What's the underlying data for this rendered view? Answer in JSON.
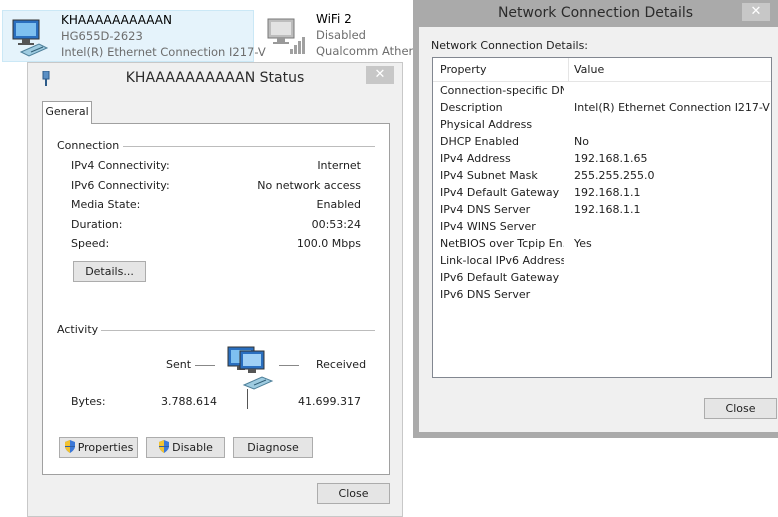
{
  "adapters": [
    {
      "name": "KHAAAAAAAAAAN",
      "line2": "HG655D-2623",
      "line3": "Intel(R) Ethernet Connection I217-V"
    },
    {
      "name": "WiFi 2",
      "line2": "Disabled",
      "line3": "Qualcomm Athero"
    }
  ],
  "status_dialog": {
    "title": "KHAAAAAAAAAAN Status",
    "close_glyph": "✕",
    "tab_general": "General",
    "connection": {
      "heading": "Connection",
      "rows": [
        {
          "label": "IPv4 Connectivity:",
          "value": "Internet"
        },
        {
          "label": "IPv6 Connectivity:",
          "value": "No network access"
        },
        {
          "label": "Media State:",
          "value": "Enabled"
        },
        {
          "label": "Duration:",
          "value": "00:53:24"
        },
        {
          "label": "Speed:",
          "value": "100.0 Mbps"
        }
      ],
      "details_button": "Details..."
    },
    "activity": {
      "heading": "Activity",
      "sent_label": "Sent",
      "received_label": "Received",
      "bytes_label": "Bytes:",
      "bytes_sent": "3.788.614",
      "bytes_received": "41.699.317"
    },
    "buttons": {
      "properties": "Properties",
      "disable": "Disable",
      "diagnose": "Diagnose",
      "close": "Close"
    }
  },
  "details_dialog": {
    "title": "Network Connection Details",
    "close_glyph": "✕",
    "caption": "Network Connection Details:",
    "columns": {
      "property": "Property",
      "value": "Value"
    },
    "rows": [
      {
        "property": "Connection-specific DN...",
        "value": ""
      },
      {
        "property": "Description",
        "value": "Intel(R) Ethernet Connection I217-V"
      },
      {
        "property": "Physical Address",
        "value": ""
      },
      {
        "property": "DHCP Enabled",
        "value": "No"
      },
      {
        "property": "IPv4 Address",
        "value": "192.168.1.65"
      },
      {
        "property": "IPv4 Subnet Mask",
        "value": "255.255.255.0"
      },
      {
        "property": "IPv4 Default Gateway",
        "value": "192.168.1.1"
      },
      {
        "property": "IPv4 DNS Server",
        "value": "192.168.1.1"
      },
      {
        "property": "IPv4 WINS Server",
        "value": ""
      },
      {
        "property": "NetBIOS over Tcpip En...",
        "value": "Yes"
      },
      {
        "property": "Link-local IPv6 Address",
        "value": ""
      },
      {
        "property": "IPv6 Default Gateway",
        "value": ""
      },
      {
        "property": "IPv6 DNS Server",
        "value": ""
      }
    ],
    "close_button": "Close"
  },
  "icons": {
    "adapter_ethernet": "ethernet-adapter-icon",
    "adapter_wifi": "wifi-adapter-icon",
    "shield": "uac-shield-icon",
    "network": "network-computers-icon"
  },
  "colors": {
    "selection_bg": "#e5f3fb",
    "window_bg": "#f0f0f0",
    "inactive_frame": "#aaaaaa"
  }
}
